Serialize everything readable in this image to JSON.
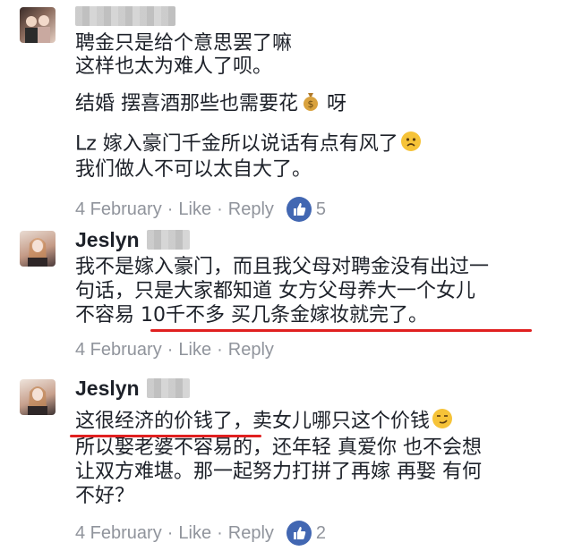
{
  "comments": [
    {
      "author": "",
      "lines": [
        "聘金只是给个意思罢了嘛",
        "这样也太为难人了呗。",
        "结婚 摆喜酒那些也需要花",
        "呀",
        "Lz 嫁入豪门千金所以说话有点有风了",
        "我们做人不可以太自大了。"
      ],
      "date": "4 February",
      "like_label": "Like",
      "reply_label": "Reply",
      "like_count": "5"
    },
    {
      "author": "Jeslyn",
      "lines": [
        "我不是嫁入豪门，而且我父母对聘金没有出过一",
        "句话，只是大家都知道 女方父母养大一个女儿",
        "不容易 10千不多 买几条金嫁妆就完了。"
      ],
      "date": "4 February",
      "like_label": "Like",
      "reply_label": "Reply"
    },
    {
      "author": "Jeslyn",
      "lines": [
        "这很经济的价钱了，卖女儿哪只这个价钱",
        "所以娶老婆不容易的，还年轻 真爱你 也不会想",
        "让双方难堪。那一起努力打拼了再嫁 再娶 有何",
        "不好？"
      ],
      "date": "4 February",
      "like_label": "Like",
      "reply_label": "Reply",
      "like_count": "2"
    }
  ],
  "separator": "·",
  "colors": {
    "accent": "#4267b2",
    "underline": "#e02020",
    "meta": "#90949c"
  },
  "icons": [
    "avatar",
    "money-bag-icon",
    "sad-face-icon",
    "smirk-face-icon",
    "thumbs-up-icon"
  ]
}
